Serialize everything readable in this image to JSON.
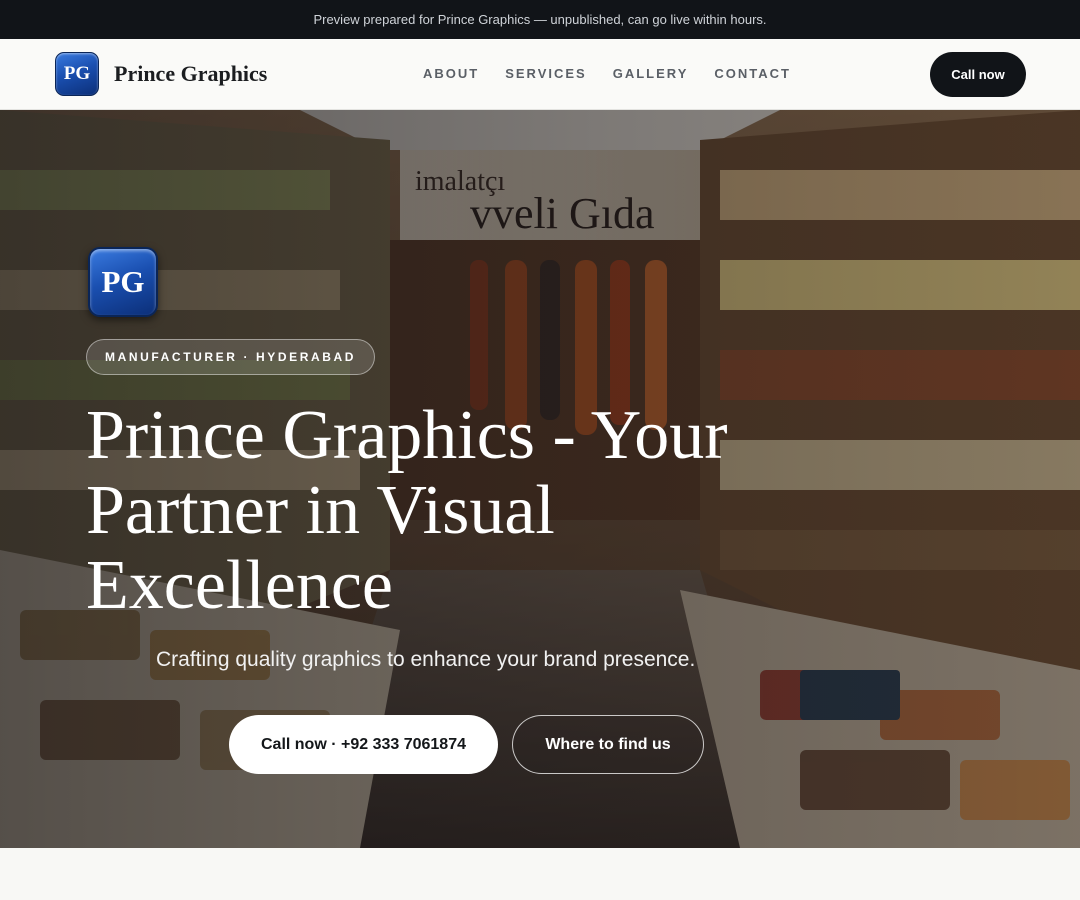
{
  "announcement": "Preview prepared for Prince Graphics — unpublished, can go live within hours.",
  "brand": {
    "logo_text": "PG",
    "name": "Prince Graphics"
  },
  "nav": {
    "links": [
      "ABOUT",
      "SERVICES",
      "GALLERY",
      "CONTACT"
    ],
    "cta": "Call now"
  },
  "hero": {
    "logo_text": "PG",
    "eyebrow": "MANUFACTURER · HYDERABAD",
    "headline": "Prince Graphics - Your Partner in Visual Excellence",
    "subhead": "Crafting quality graphics to enhance your brand presence.",
    "primary_button": "Call now · +92 333 7061874",
    "secondary_button": "Where to find us",
    "image_description_icon": "shop-interior-photo",
    "sign_text": "imalatçı Evveli Gıda"
  },
  "colors": {
    "dark": "#111418",
    "logo_blue": "#1a4fb0",
    "background": "#f8f8f5"
  }
}
